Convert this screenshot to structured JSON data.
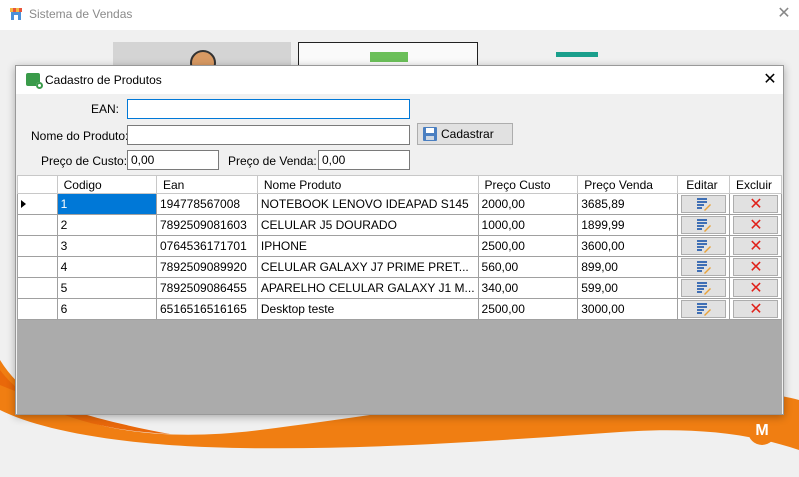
{
  "app": {
    "title": "Sistema de Vendas"
  },
  "dialog": {
    "title": "Cadastro de Produtos",
    "form": {
      "ean_label": "EAN:",
      "ean_value": "",
      "nome_label": "Nome do Produto:",
      "nome_value": "",
      "custo_label": "Preço de Custo:",
      "custo_value": "0,00",
      "venda_label": "Preço de Venda:",
      "venda_value": "0,00",
      "cadastrar_label": "Cadastrar"
    },
    "grid": {
      "columns": [
        "Codigo",
        "Ean",
        "Nome Produto",
        "Preço Custo",
        "Preço Venda",
        "Editar",
        "Excluir"
      ],
      "rows": [
        {
          "codigo": "1",
          "ean": "194778567008",
          "nome": "NOTEBOOK LENOVO IDEAPAD S145",
          "custo": "2000,00",
          "venda": "3685,89"
        },
        {
          "codigo": "2",
          "ean": "7892509081603",
          "nome": "CELULAR J5 DOURADO",
          "custo": "1000,00",
          "venda": "1899,99"
        },
        {
          "codigo": "3",
          "ean": "0764536171701",
          "nome": "IPHONE",
          "custo": "2500,00",
          "venda": "3600,00"
        },
        {
          "codigo": "4",
          "ean": "7892509089920",
          "nome": "CELULAR GALAXY J7 PRIME PRET...",
          "custo": "560,00",
          "venda": "899,00"
        },
        {
          "codigo": "5",
          "ean": "7892509086455",
          "nome": "APARELHO CELULAR GALAXY J1 M...",
          "custo": "340,00",
          "venda": "599,00"
        },
        {
          "codigo": "6",
          "ean": "6516516516165",
          "nome": "Desktop teste",
          "custo": "2500,00",
          "venda": "3000,00"
        }
      ]
    }
  },
  "logo": {
    "letter": "M"
  },
  "colors": {
    "selection": "#0078d7",
    "accent": "#f07e12",
    "delete": "#e0221b"
  }
}
